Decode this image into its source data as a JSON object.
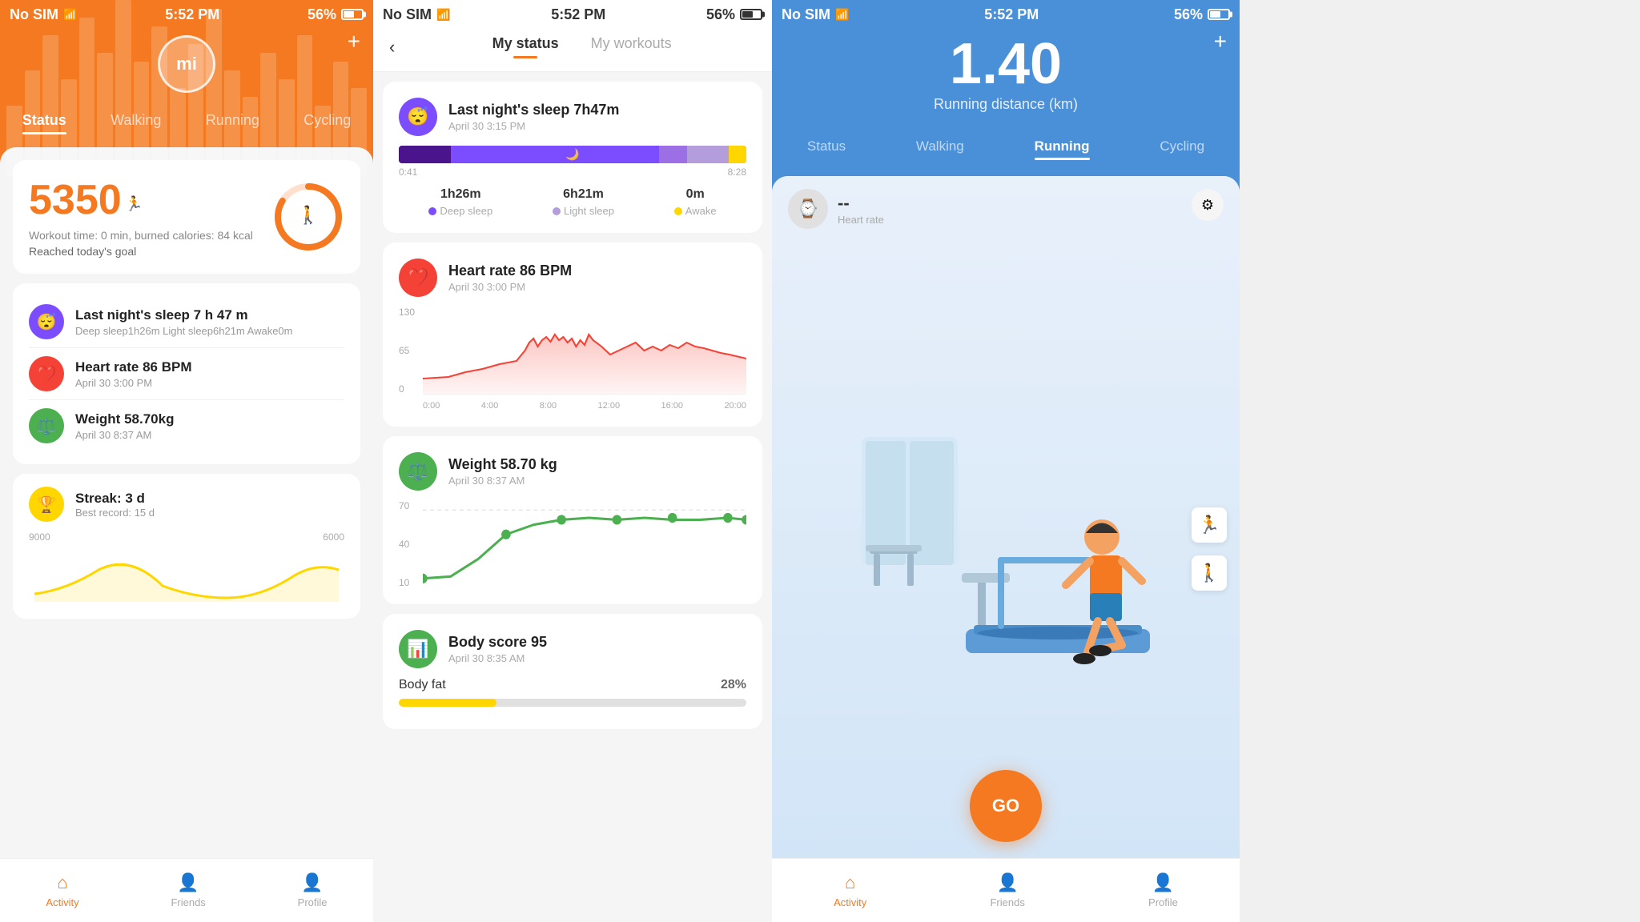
{
  "panel1": {
    "statusBar": {
      "carrier": "No SIM",
      "wifi": "wifi",
      "time": "5:52 PM",
      "battery": "56%"
    },
    "logo": "mi",
    "plus": "+",
    "tabs": [
      "Status",
      "Walking",
      "Running",
      "Cycling"
    ],
    "activeTab": "Status",
    "steps": {
      "value": "5350",
      "workoutTime": "Workout time: 0 min, burned calories: 84 kcal",
      "goal": "Reached today's goal"
    },
    "listItems": [
      {
        "icon": "sleep",
        "iconBg": "purple",
        "title": "Last night's sleep 7 h 47 m",
        "sub": "Deep sleep1h26m Light sleep6h21m Awake0m"
      },
      {
        "icon": "heart",
        "iconBg": "red",
        "title": "Heart rate 86 BPM",
        "sub": "April 30 3:00 PM"
      },
      {
        "icon": "weight",
        "iconBg": "green",
        "title": "Weight 58.70kg",
        "sub": "April 30 8:37 AM"
      }
    ],
    "streak": {
      "title": "Streak: 3 d",
      "sub": "Best record: 15 d"
    },
    "chartLabels": [
      "9000",
      "6000"
    ],
    "bottomNav": {
      "items": [
        {
          "label": "Activity",
          "active": true
        },
        {
          "label": "Friends",
          "active": false
        },
        {
          "label": "Profile",
          "active": false
        }
      ]
    }
  },
  "panel2": {
    "statusBar": {
      "carrier": "No SIM",
      "time": "5:52 PM",
      "battery": "56%"
    },
    "header": {
      "tabs": [
        "My status",
        "My workouts"
      ],
      "activeTab": "My status"
    },
    "cards": [
      {
        "id": "sleep",
        "iconBg": "purple",
        "title": "Last night's sleep 7h47m",
        "date": "April 30 3:15 PM",
        "timeStart": "0:41",
        "timeEnd": "8:28",
        "stats": [
          {
            "val": "1h26m",
            "label": "Deep sleep",
            "dotColor": "#7c4dff"
          },
          {
            "val": "6h21m",
            "label": "Light sleep",
            "dotColor": "#b39ddb"
          },
          {
            "val": "0m",
            "label": "Awake",
            "dotColor": "#ffd600"
          }
        ]
      },
      {
        "id": "heartrate",
        "iconBg": "red",
        "title": "Heart rate 86 BPM",
        "date": "April 30 3:00 PM",
        "yLabels": [
          "130",
          "65",
          "0"
        ],
        "xLabels": [
          "0:00",
          "4:00",
          "8:00",
          "12:00",
          "16:00",
          "20:00"
        ]
      },
      {
        "id": "weight",
        "iconBg": "green",
        "title": "Weight 58.70 kg",
        "date": "April 30 8:37 AM",
        "yLabels": [
          "70",
          "40",
          "10"
        ]
      },
      {
        "id": "bodyscore",
        "iconBg": "green2",
        "title": "Body score 95",
        "date": "April 30 8:35 AM",
        "bodyFat": "Body fat",
        "bodyFatPct": "28%",
        "bodyFatWidth": "28%"
      }
    ]
  },
  "panel3": {
    "statusBar": {
      "carrier": "No SIM",
      "time": "5:52 PM",
      "battery": "56%"
    },
    "distance": "1.40",
    "distanceUnit": "Running distance (km)",
    "tabs": [
      "Status",
      "Walking",
      "Running",
      "Cycling"
    ],
    "activeTab": "Running",
    "heartRate": {
      "value": "--",
      "label": "Heart rate"
    },
    "goLabel": "GO",
    "bottomNav": {
      "items": [
        {
          "label": "Activity",
          "active": true
        },
        {
          "label": "Friends",
          "active": false
        },
        {
          "label": "Profile",
          "active": false
        }
      ]
    }
  }
}
